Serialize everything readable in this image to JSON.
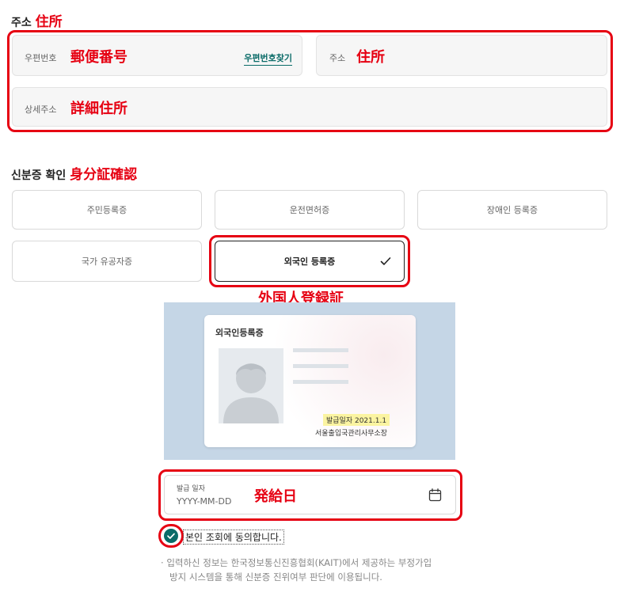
{
  "address": {
    "section_title": "주소",
    "section_note": "住所",
    "postal_label": "우편번호",
    "postal_note": "郵便番号",
    "find_postal": "우편번호찾기",
    "addr_label": "주소",
    "addr_note": "住所",
    "detail_label": "상세주소",
    "detail_note": "詳細住所"
  },
  "id_verify": {
    "section_title": "신분증 확인",
    "section_note": "身分証確認",
    "options": [
      "주민등록증",
      "운전면허증",
      "장애인 등록증",
      "국가 유공자증",
      "외국인 등록증"
    ],
    "selected_note": "外国人登録証"
  },
  "card": {
    "title": "외국인등록증",
    "issue_date": "발급일자 2021.1.1",
    "issuer": "서울출입국관리사무소장"
  },
  "issue_date_field": {
    "label": "발급 일자",
    "placeholder": "YYYY-MM-DD",
    "note": "発給日"
  },
  "consent": {
    "label": "본인 조회에 동의합니다.",
    "notice_line1": "입력하신 정보는 한국정보통신진흥협회(KAIT)에서 제공하는 부정가입",
    "notice_line2": "방지 시스템을 통해 신분증 진위여부 판단에 이용됩니다."
  },
  "colors": {
    "annotation_red": "#e60012",
    "accent_teal": "#0a6b68",
    "card_background": "#c5d6e6"
  }
}
